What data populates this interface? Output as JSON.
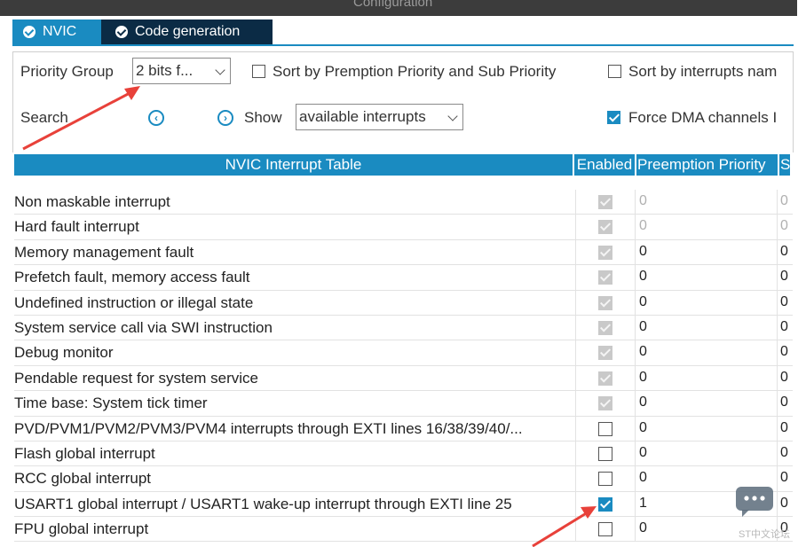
{
  "window": {
    "title": "Configuration"
  },
  "tabs": [
    {
      "label": "NVIC",
      "active": true
    },
    {
      "label": "Code generation",
      "active": false
    }
  ],
  "toolbar": {
    "priority_group_label": "Priority Group",
    "priority_group_value": "2 bits f...",
    "sort_premption_label": "Sort by Premption Priority and Sub Priority",
    "sort_premption_checked": false,
    "sort_interrupts_label": "Sort by interrupts nam",
    "sort_interrupts_checked": false,
    "search_label": "Search",
    "search_prev_icon": "circle-chevron-left-icon",
    "search_next_icon": "circle-chevron-right-icon",
    "show_label": "Show",
    "show_value": "available interrupts",
    "force_dma_label": "Force DMA channels I",
    "force_dma_checked": true
  },
  "table": {
    "headers": {
      "name": "NVIC Interrupt Table",
      "enabled": "Enabled",
      "preemption": "Preemption Priority",
      "sub": "S"
    },
    "rows": [
      {
        "name": "Non maskable interrupt",
        "enabled": "locked",
        "preemption": "0",
        "sub": "0",
        "dim": true
      },
      {
        "name": "Hard fault interrupt",
        "enabled": "locked",
        "preemption": "0",
        "sub": "0",
        "dim": true
      },
      {
        "name": "Memory management fault",
        "enabled": "locked",
        "preemption": "0",
        "sub": "0",
        "dim": false
      },
      {
        "name": "Prefetch fault, memory access fault",
        "enabled": "locked",
        "preemption": "0",
        "sub": "0",
        "dim": false
      },
      {
        "name": "Undefined instruction or illegal state",
        "enabled": "locked",
        "preemption": "0",
        "sub": "0",
        "dim": false
      },
      {
        "name": "System service call via SWI instruction",
        "enabled": "locked",
        "preemption": "0",
        "sub": "0",
        "dim": false
      },
      {
        "name": "Debug monitor",
        "enabled": "locked",
        "preemption": "0",
        "sub": "0",
        "dim": false
      },
      {
        "name": "Pendable request for system service",
        "enabled": "locked",
        "preemption": "0",
        "sub": "0",
        "dim": false
      },
      {
        "name": "Time base: System tick timer",
        "enabled": "locked",
        "preemption": "0",
        "sub": "0",
        "dim": false
      },
      {
        "name": "PVD/PVM1/PVM2/PVM3/PVM4 interrupts through EXTI lines 16/38/39/40/...",
        "enabled": "off",
        "preemption": "0",
        "sub": "0",
        "dim": false
      },
      {
        "name": "Flash global interrupt",
        "enabled": "off",
        "preemption": "0",
        "sub": "0",
        "dim": false
      },
      {
        "name": "RCC global interrupt",
        "enabled": "off",
        "preemption": "0",
        "sub": "0",
        "dim": false
      },
      {
        "name": "USART1 global interrupt / USART1 wake-up interrupt through EXTI line 25",
        "enabled": "on",
        "preemption": "1",
        "sub": "0",
        "dim": false
      },
      {
        "name": "FPU global interrupt",
        "enabled": "off",
        "preemption": "0",
        "sub": "0",
        "dim": false
      }
    ]
  },
  "watermark": {
    "icon": "chat-bubble-icon",
    "text": "ST中文论坛"
  },
  "colors": {
    "accent": "#1a8bc1",
    "annotation_arrow": "#e8413a",
    "tab_dark": "#0b2b45"
  }
}
